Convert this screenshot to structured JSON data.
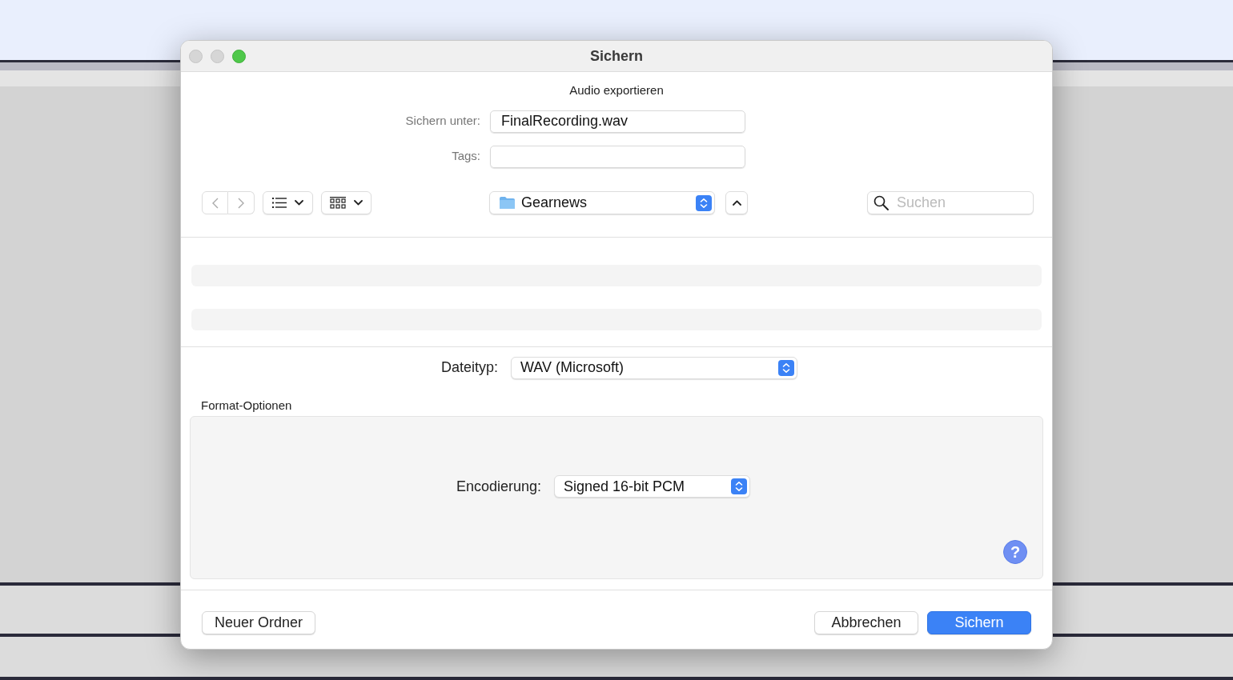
{
  "window": {
    "title": "Sichern"
  },
  "dialog": {
    "heading": "Audio exportieren",
    "save_as": {
      "label": "Sichern unter:",
      "value": "FinalRecording.wav"
    },
    "tags": {
      "label": "Tags:"
    },
    "location": {
      "folder": "Gearnews"
    },
    "search": {
      "placeholder": "Suchen"
    },
    "file_type": {
      "label": "Dateityp:",
      "value": "WAV (Microsoft)"
    },
    "format_options": {
      "title": "Format-Optionen",
      "encoding": {
        "label": "Encodierung:",
        "value": "Signed 16-bit PCM"
      }
    },
    "help": "?",
    "buttons": [
      {
        "label": "Neuer Ordner",
        "kind": "secondary"
      },
      {
        "label": "Abbrechen",
        "kind": "secondary"
      },
      {
        "label": "Sichern",
        "kind": "primary"
      }
    ]
  }
}
